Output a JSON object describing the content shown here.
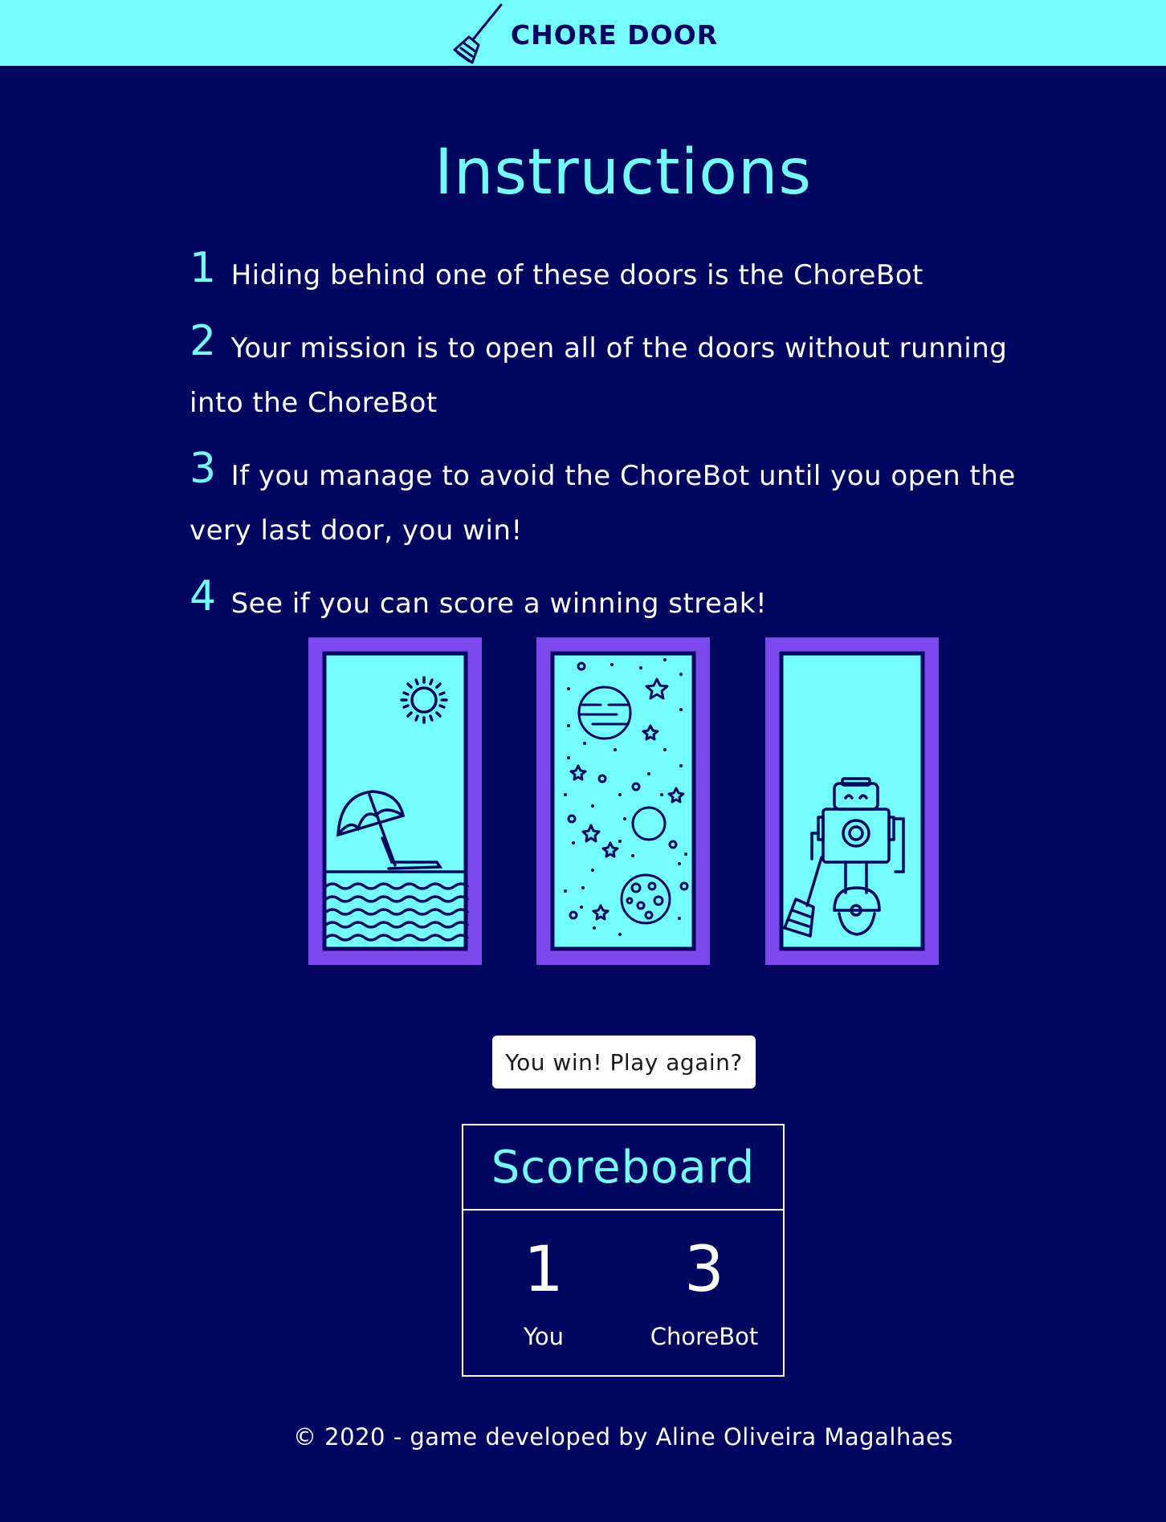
{
  "header": {
    "brand": "CHORE DOOR",
    "logo_icon": "broom-icon"
  },
  "instructions": {
    "title": "Instructions",
    "steps": [
      {
        "num": "1",
        "text": "Hiding behind one of these doors is the ChoreBot"
      },
      {
        "num": "2",
        "text": "Your mission is to open all of the doors without running into the ChoreBot"
      },
      {
        "num": "3",
        "text": "If you manage to avoid the ChoreBot until you open the very last door, you win!"
      },
      {
        "num": "4",
        "text": "See if you can score a winning streak!"
      }
    ]
  },
  "doors": [
    {
      "scene": "beach-door-icon",
      "state": "open"
    },
    {
      "scene": "space-door-icon",
      "state": "open"
    },
    {
      "scene": "chorebot-door-icon",
      "state": "open"
    }
  ],
  "game": {
    "button_label": "You win! Play again?"
  },
  "scoreboard": {
    "title": "Scoreboard",
    "you_score": "1",
    "you_label": "You",
    "bot_score": "3",
    "bot_label": "ChoreBot"
  },
  "footer": {
    "text": "© 2020 - game developed by Aline Oliveira Magalhaes"
  },
  "colors": {
    "background": "#000660",
    "accent": "#73fdff",
    "door_frame": "#7d49ec",
    "text": "#ffffff"
  }
}
